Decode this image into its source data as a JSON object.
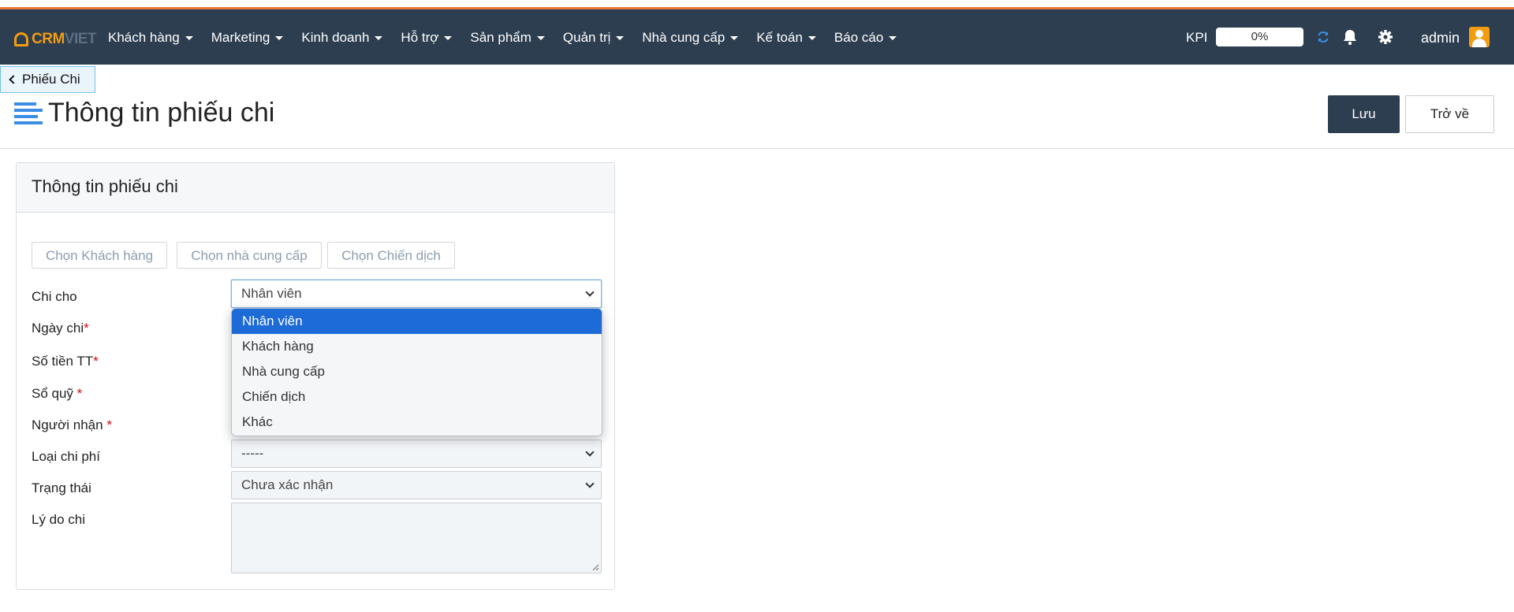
{
  "brand": {
    "logo_left": "CRM",
    "logo_right": "VIET"
  },
  "nav": {
    "items": [
      {
        "label": "Khách hàng"
      },
      {
        "label": "Marketing"
      },
      {
        "label": "Kinh doanh"
      },
      {
        "label": "Hỗ trợ"
      },
      {
        "label": "Sản phẩm"
      },
      {
        "label": "Quản trị"
      },
      {
        "label": "Nhà cung cấp"
      },
      {
        "label": "Kế toán"
      },
      {
        "label": "Báo cáo"
      }
    ],
    "kpi_label": "KPI",
    "kpi_value": "0%",
    "user": "admin"
  },
  "breadcrumb": {
    "label": "Phiếu Chi"
  },
  "page": {
    "title": "Thông tin phiếu chi",
    "save_label": "Lưu",
    "back_label": "Trở về"
  },
  "form": {
    "panel_title": "Thông tin phiếu chi",
    "chips": [
      "Chọn Khách hàng",
      "Chọn nhà cung cấp",
      "Chọn Chiến dịch"
    ],
    "labels": {
      "chi_cho": "Chi cho",
      "ngay_chi": "Ngày chi",
      "so_tien": "Số tiền TT",
      "so_quy": "Sổ quỹ",
      "nguoi_nhan": "Người nhận",
      "loai_chi_phi": "Loại chi phí",
      "trang_thai": "Trạng thái",
      "ly_do": "Lý do chi"
    },
    "required_mark": "*",
    "values": {
      "chi_cho": "Nhân viên",
      "loai_chi_phi": "-----",
      "trang_thai": "Chưa xác nhận",
      "ly_do": ""
    },
    "chi_cho_options": [
      "Nhân viên",
      "Khách hàng",
      "Nhà cung cấp",
      "Chiến dịch",
      "Khác"
    ],
    "chi_cho_selected": "Nhân viên"
  },
  "colors": {
    "nav_bg": "#2c3e50",
    "accent": "#e8743b",
    "brand": "#f39c12",
    "selected_option": "#1c6bd6"
  }
}
